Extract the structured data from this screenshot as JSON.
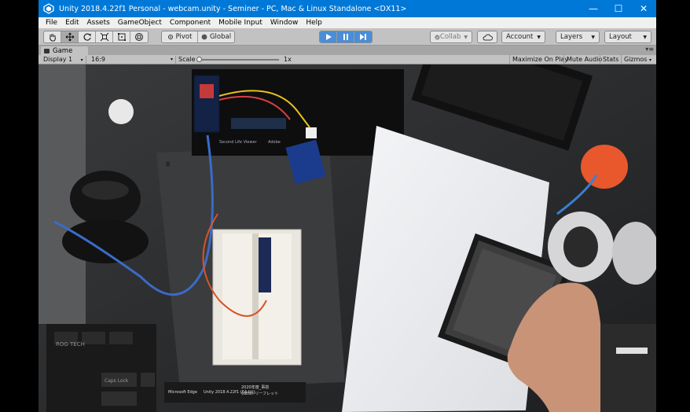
{
  "window": {
    "title": "Unity 2018.4.22f1 Personal - webcam.unity - Seminer - PC, Mac & Linux Standalone <DX11>",
    "accent": "#0078d7",
    "minimize_glyph": "—",
    "maximize_glyph": "☐",
    "close_glyph": "✕"
  },
  "menu": [
    "File",
    "Edit",
    "Assets",
    "GameObject",
    "Component",
    "Mobile Input",
    "Window",
    "Help"
  ],
  "toolbar": {
    "pivot_label": "Pivot",
    "global_label": "Global",
    "collab_label": "Collab",
    "account_label": "Account",
    "layers_label": "Layers",
    "layout_label": "Layout",
    "play_color": "#4a8dd8"
  },
  "tab": {
    "label": "Game"
  },
  "game_bar": {
    "display": "Display 1",
    "aspect": "16:9",
    "scale_label": "Scale",
    "scale_value": "1x",
    "maximize_on_play": "Maximize On Play",
    "mute_audio": "Mute Audio",
    "stats": "Stats",
    "gizmos": "Gizmos"
  },
  "viewport": {
    "breadboard_label": "R",
    "screen_labels": [
      "Second Life Viewer",
      "Adobe"
    ],
    "desk_labels": [
      "Microsoft Edge",
      "Unity 2018.4.22f1 (64-bit)",
      "2020年度_事前",
      "vation-リーフレット"
    ],
    "keyboard_label": "ROG TECH",
    "key_label": "Caps Lock"
  }
}
